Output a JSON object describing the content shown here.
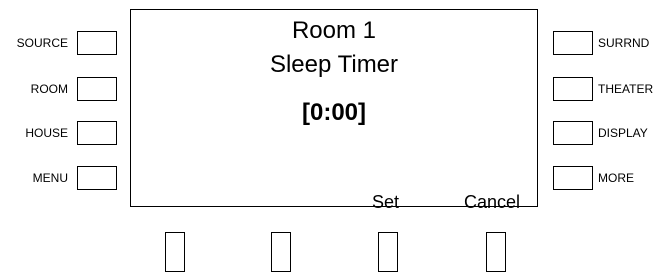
{
  "left_buttons": [
    "SOURCE",
    "ROOM",
    "HOUSE",
    "MENU"
  ],
  "right_buttons": [
    "SURRND",
    "THEATER",
    "DISPLAY",
    "MORE"
  ],
  "screen": {
    "line1": "Room 1",
    "line2": "Sleep Timer",
    "timer": "[0:00]",
    "softkeys": [
      "Set",
      "Cancel"
    ]
  }
}
